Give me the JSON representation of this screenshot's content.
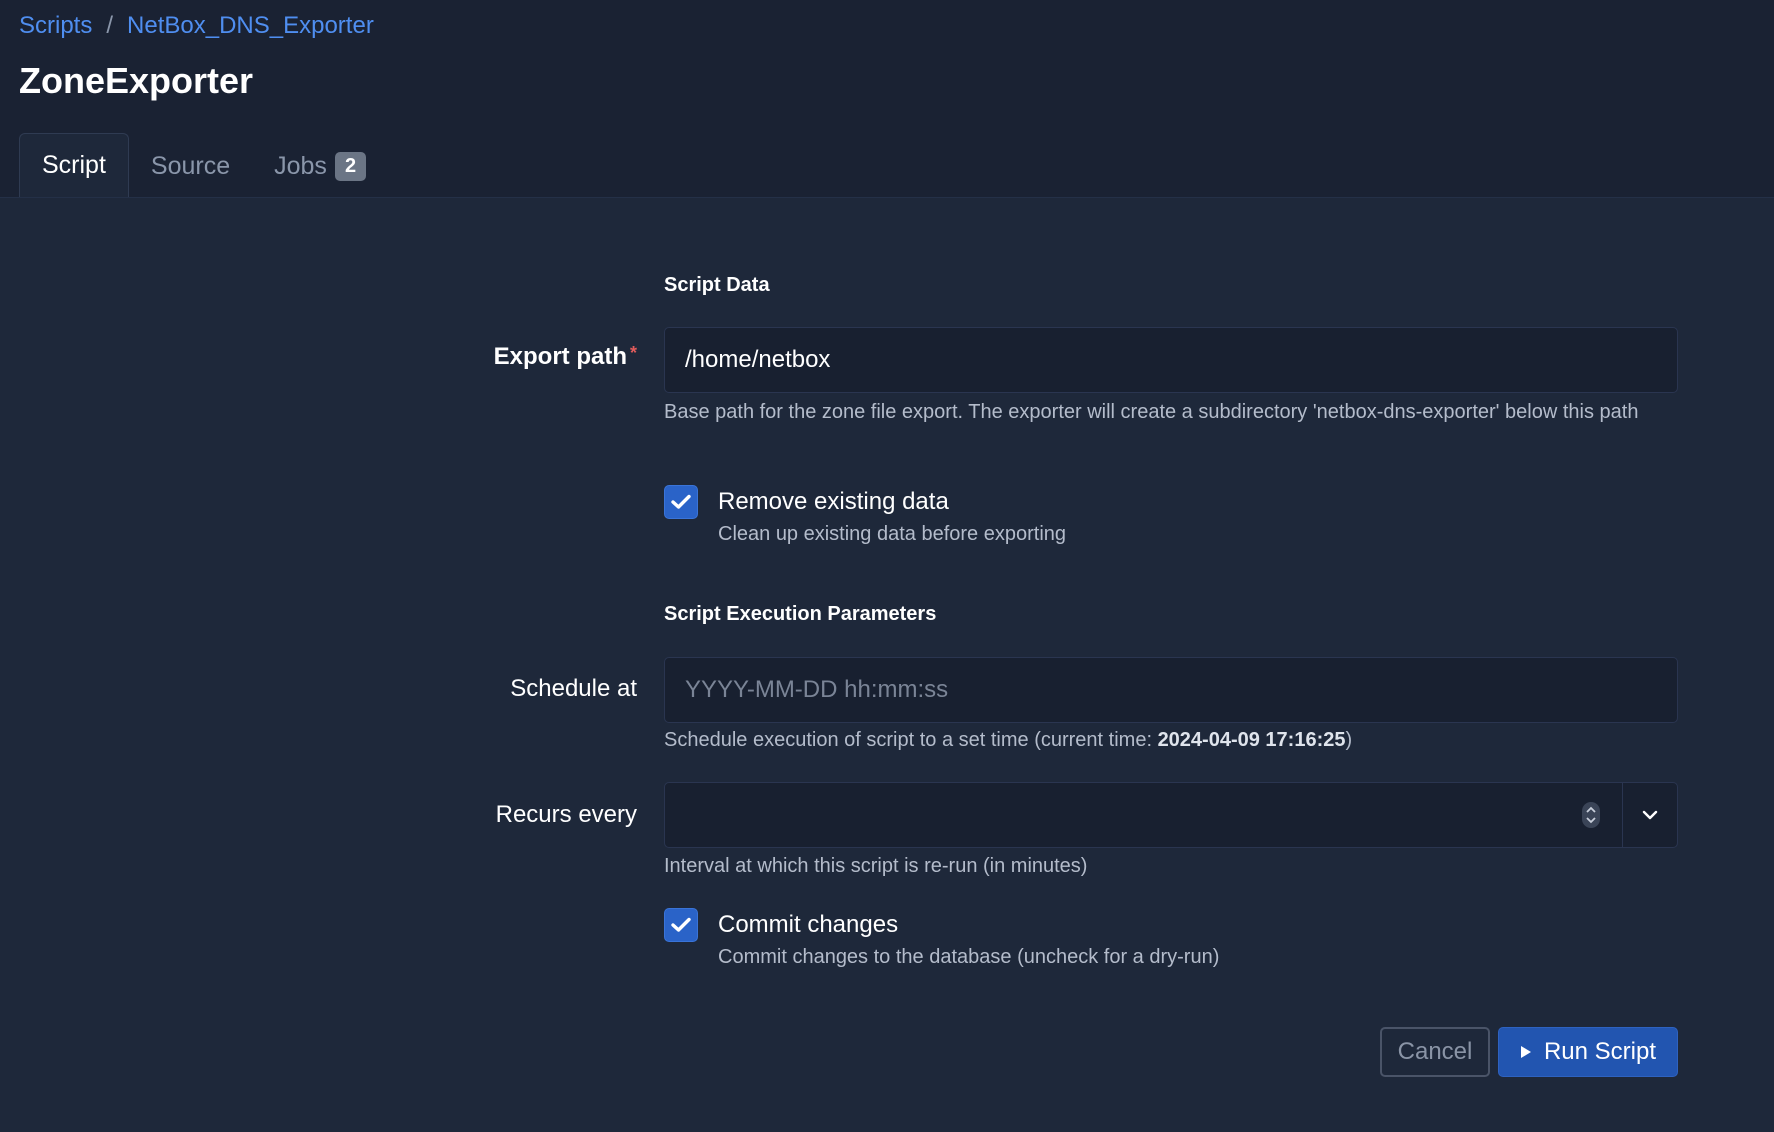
{
  "breadcrumb": {
    "items": [
      "Scripts",
      "NetBox_DNS_Exporter"
    ],
    "separator": "/"
  },
  "page": {
    "title": "ZoneExporter"
  },
  "tabs": [
    {
      "label": "Script",
      "active": true
    },
    {
      "label": "Source",
      "active": false
    },
    {
      "label": "Jobs",
      "active": false,
      "badge": "2"
    }
  ],
  "form": {
    "script_data_title": "Script Data",
    "export_path": {
      "label": "Export path",
      "required_mark": "*",
      "value": "/home/netbox",
      "help": "Base path for the zone file export. The exporter will create a subdirectory 'netbox-dns-exporter' below this path"
    },
    "remove_existing": {
      "label": "Remove existing data",
      "checked": true,
      "help": "Clean up existing data before exporting"
    },
    "execution_title": "Script Execution Parameters",
    "schedule_at": {
      "label": "Schedule at",
      "placeholder": "YYYY-MM-DD hh:mm:ss",
      "help_prefix": "Schedule execution of script to a set time (current time: ",
      "current_time": "2024-04-09 17:16:25",
      "help_suffix": ")"
    },
    "recurs_every": {
      "label": "Recurs every",
      "value": "",
      "help": "Interval at which this script is re-run (in minutes)"
    },
    "commit_changes": {
      "label": "Commit changes",
      "checked": true,
      "help": "Commit changes to the database (uncheck for a dry-run)"
    }
  },
  "actions": {
    "cancel_label": "Cancel",
    "run_label": "Run Script"
  },
  "icons": {
    "checkbox": "check-icon",
    "run": "play-icon",
    "dropdown": "chevron-down-icon",
    "spinner": "spinner-arrows-icon"
  },
  "colors": {
    "accent": "#2255b0",
    "link": "#4f8ef0",
    "background": "#1e283a",
    "required": "#e25c5c"
  }
}
